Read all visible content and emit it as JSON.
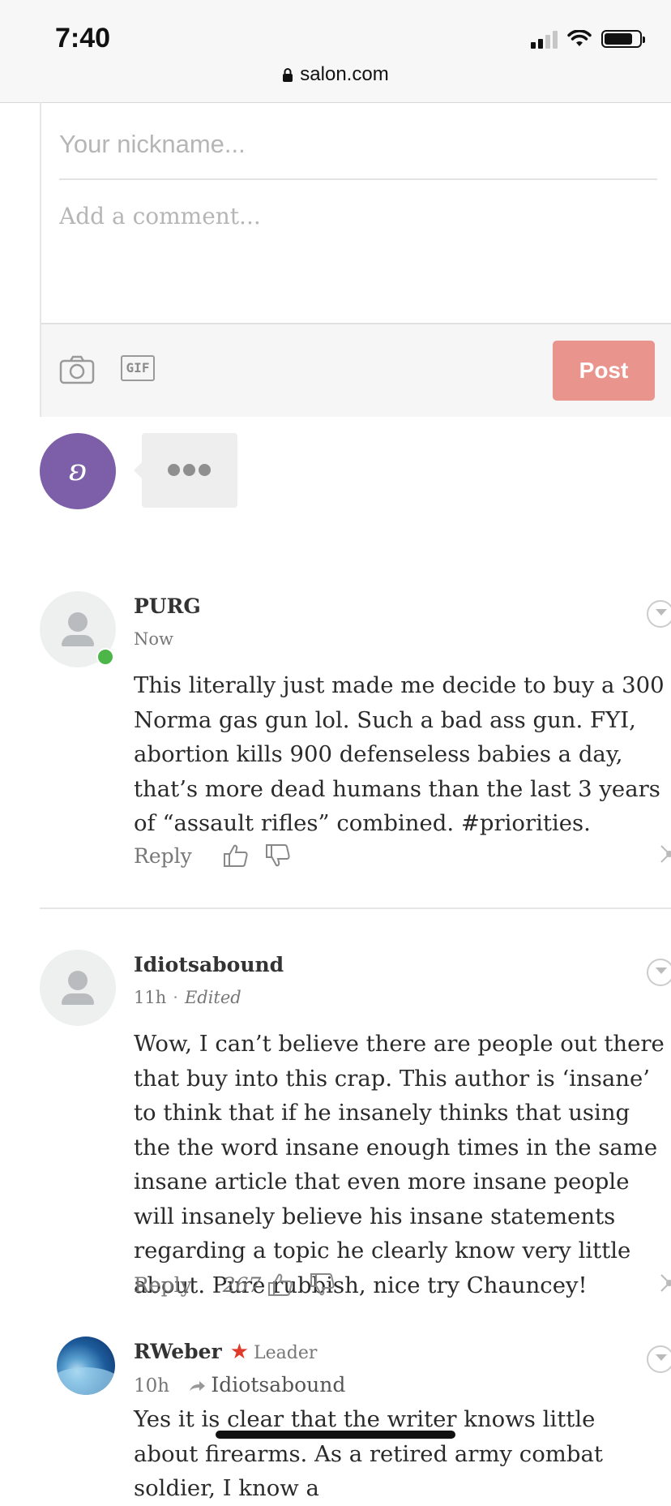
{
  "status_bar": {
    "time": "7:40"
  },
  "browser": {
    "domain": "salon.com"
  },
  "composer": {
    "nickname_placeholder": "Your nickname...",
    "comment_placeholder": "Add a comment...",
    "gif_label": "GIF",
    "post_label": "Post"
  },
  "typing": {
    "avatar_letter": "ʚ"
  },
  "comments": [
    {
      "author": "PURG",
      "time": "Now",
      "text": "This literally just made me decide to buy a 300 Norma gas gun lol. Such a bad ass gun. FYI, abortion kills 900 defenseless babies a day, that’s more dead humans than the last 3 years of “assault rifles” combined. #priorities.",
      "reply_label": "Reply"
    },
    {
      "author": "Idiotsabound",
      "time": "11h",
      "edited_label": "Edited",
      "text": "Wow, I can’t believe there are people out there that buy into this crap.  This author is ‘insane’ to think that if he insanely thinks that using the the word insane enough times in the same insane article that even more insane people will insanely believe his insane statements regarding a topic he clearly know very little about.  Pure rubbish, nice try Chauncey!",
      "reply_label": "Reply",
      "votes": "267"
    },
    {
      "author": "RWeber",
      "badge": "Leader",
      "time": "10h",
      "reply_to": "Idiotsabound",
      "text": "Yes it is clear that the writer knows little about firearms. As a retired army combat soldier, I know a"
    }
  ],
  "colors": {
    "post_button": "#e9958d",
    "avatar_purple": "#7c5fa8",
    "online": "#4cb648",
    "star": "#e03a2b"
  }
}
